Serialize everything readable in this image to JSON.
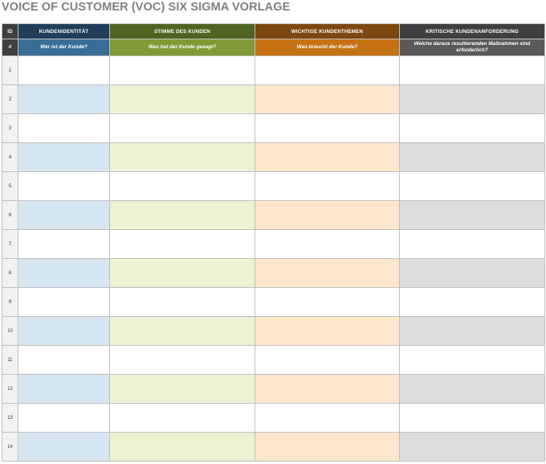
{
  "title": "VOICE OF CUSTOMER (VOC) SIX SIGMA VORLAGE",
  "colors": {
    "title": "#7f7f7f",
    "id_header": "#3f3f3f",
    "kundenidentitaet_header": "#203d5a",
    "kundenidentitaet_sub": "#3a6e96",
    "stimme_header": "#4e6423",
    "stimme_sub": "#7f9b37",
    "themen_header": "#7d4710",
    "themen_sub": "#c57215",
    "anforderung_header": "#3f3f3f",
    "anforderung_sub": "#595959"
  },
  "columns": [
    {
      "key": "id",
      "header": "ID",
      "subheader": "#"
    },
    {
      "key": "kundenidentitaet",
      "header": "KUNDENIDENTITÄT",
      "subheader": "Wer ist der Kunde?"
    },
    {
      "key": "stimme",
      "header": "STIMME DES KUNDEN",
      "subheader": "Was hat der Kunde gesagt?"
    },
    {
      "key": "themen",
      "header": "WICHTIGE KUNDENTHEMEN",
      "subheader": "Was braucht der Kunde?"
    },
    {
      "key": "anforderung",
      "header": "KRITISCHE KUNDENANFORDERUNG",
      "subheader": "Welche daraus resultierenden Maßnahmen sind erforderlich?"
    }
  ],
  "rows": [
    {
      "id": "1",
      "kundenidentitaet": "",
      "stimme": "",
      "themen": "",
      "anforderung": ""
    },
    {
      "id": "2",
      "kundenidentitaet": "",
      "stimme": "",
      "themen": "",
      "anforderung": ""
    },
    {
      "id": "3",
      "kundenidentitaet": "",
      "stimme": "",
      "themen": "",
      "anforderung": ""
    },
    {
      "id": "4",
      "kundenidentitaet": "",
      "stimme": "",
      "themen": "",
      "anforderung": ""
    },
    {
      "id": "5",
      "kundenidentitaet": "",
      "stimme": "",
      "themen": "",
      "anforderung": ""
    },
    {
      "id": "6",
      "kundenidentitaet": "",
      "stimme": "",
      "themen": "",
      "anforderung": ""
    },
    {
      "id": "7",
      "kundenidentitaet": "",
      "stimme": "",
      "themen": "",
      "anforderung": ""
    },
    {
      "id": "8",
      "kundenidentitaet": "",
      "stimme": "",
      "themen": "",
      "anforderung": ""
    },
    {
      "id": "9",
      "kundenidentitaet": "",
      "stimme": "",
      "themen": "",
      "anforderung": ""
    },
    {
      "id": "10",
      "kundenidentitaet": "",
      "stimme": "",
      "themen": "",
      "anforderung": ""
    },
    {
      "id": "11",
      "kundenidentitaet": "",
      "stimme": "",
      "themen": "",
      "anforderung": ""
    },
    {
      "id": "12",
      "kundenidentitaet": "",
      "stimme": "",
      "themen": "",
      "anforderung": ""
    },
    {
      "id": "13",
      "kundenidentitaet": "",
      "stimme": "",
      "themen": "",
      "anforderung": ""
    },
    {
      "id": "14",
      "kundenidentitaet": "",
      "stimme": "",
      "themen": "",
      "anforderung": ""
    }
  ]
}
